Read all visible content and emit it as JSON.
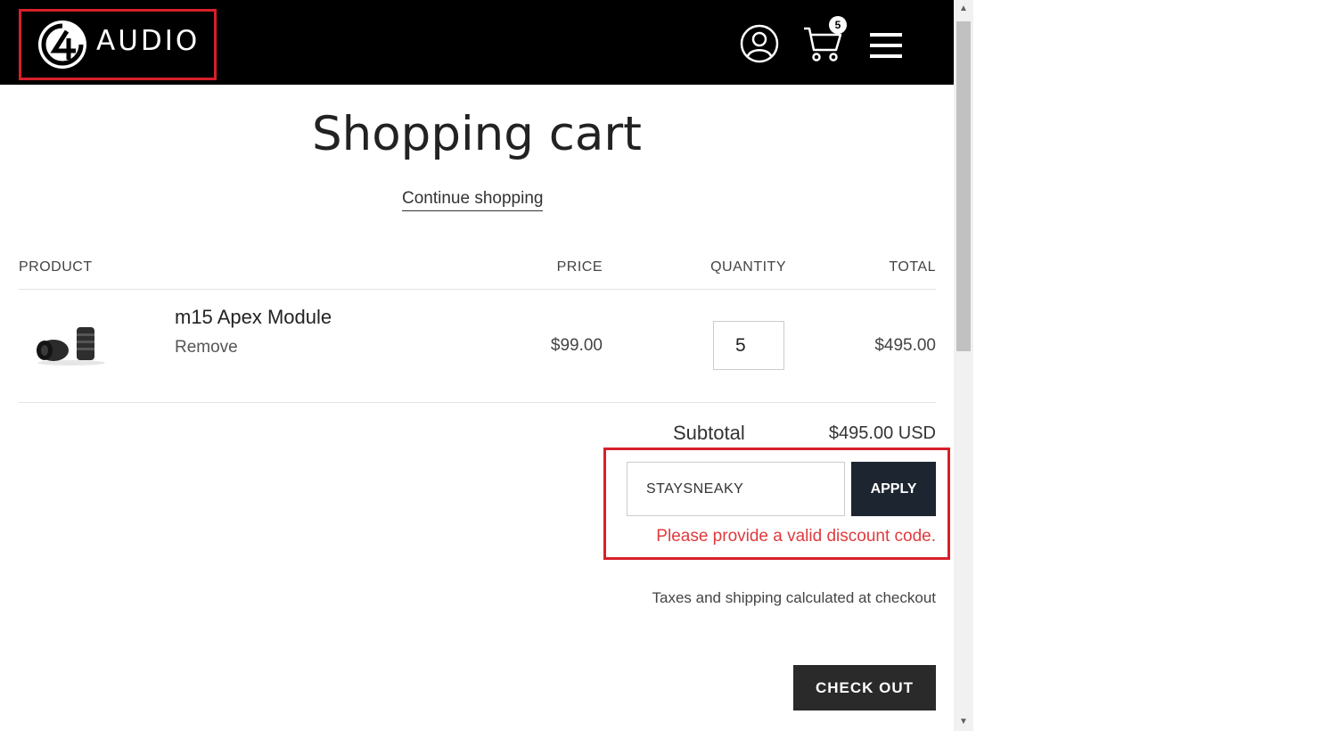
{
  "header": {
    "brand_mark": "64",
    "brand_name": "AUDIO",
    "account_icon": "user-circle-icon",
    "cart_icon": "shopping-cart-icon",
    "cart_count": "5",
    "menu_icon": "hamburger-menu-icon"
  },
  "cart": {
    "title": "Shopping cart",
    "continue_label": "Continue shopping",
    "columns": {
      "product": "PRODUCT",
      "price": "PRICE",
      "quantity": "QUANTITY",
      "total": "TOTAL"
    },
    "items": [
      {
        "name": "m15 Apex Module",
        "remove_label": "Remove",
        "price": "$99.00",
        "quantity": "5",
        "total": "$495.00"
      }
    ],
    "subtotal_label": "Subtotal",
    "subtotal_value": "$495.00 USD",
    "discount": {
      "value": "STAYSNEAKY",
      "apply_label": "APPLY",
      "error": "Please provide a valid discount code."
    },
    "taxes_note": "Taxes and shipping calculated at checkout",
    "checkout_label": "CHECK OUT"
  },
  "colors": {
    "highlight": "#d6202a",
    "error": "#e03a3e",
    "apply_bg": "#1d2530",
    "header_bg": "#000000"
  }
}
